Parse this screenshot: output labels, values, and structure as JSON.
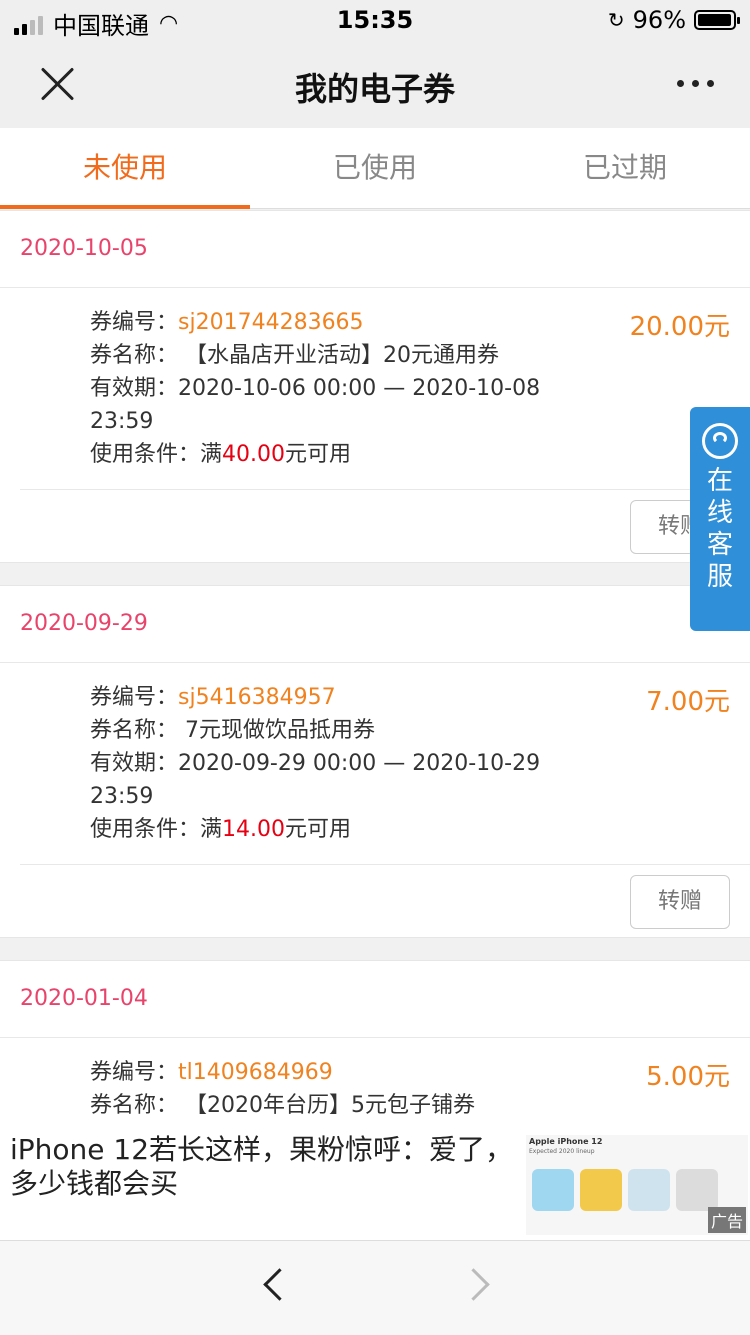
{
  "status_bar": {
    "carrier": "中国联通",
    "time": "15:35",
    "battery": "96%",
    "battery_level": 0.96
  },
  "nav": {
    "title": "我的电子券"
  },
  "tabs": [
    {
      "label": "未使用",
      "active": true
    },
    {
      "label": "已使用",
      "active": false
    },
    {
      "label": "已过期",
      "active": false
    }
  ],
  "labels": {
    "code": "券编号：",
    "name": "券名称：",
    "validity": "有效期：",
    "condition_prefix": "使用条件：满",
    "condition_suffix": "元可用",
    "gift_button": "转赠"
  },
  "coupons": [
    {
      "date": "2020-10-05",
      "code": "sj201744283665",
      "name": " 【水晶店开业活动】20元通用券",
      "validity": "2020-10-06 00:00 — 2020-10-08 23:59",
      "min_amount": "40.00",
      "amount": "20.00元"
    },
    {
      "date": "2020-09-29",
      "code": "sj5416384957",
      "name": " 7元现做饮品抵用券",
      "validity": "2020-09-29 00:00 — 2020-10-29 23:59",
      "min_amount": "14.00",
      "amount": "7.00元"
    },
    {
      "date": "2020-01-04",
      "code": "tl1409684969",
      "name": " 【2020年台历】5元包子铺券",
      "amount": "5.00元"
    }
  ],
  "service": {
    "label": "在线客服",
    "color": "#2f8fd8"
  },
  "ad": {
    "text": "iPhone 12若长这样，果粉惊呼：爱了，多少钱都会买",
    "image_title": "Apple iPhone 12",
    "image_subtitle": "Expected 2020 lineup",
    "tag": "广告"
  },
  "colors": {
    "accent": "#f26a1b",
    "date": "#e8436b",
    "amount": "#f0821f",
    "min_amount": "#e60012"
  }
}
